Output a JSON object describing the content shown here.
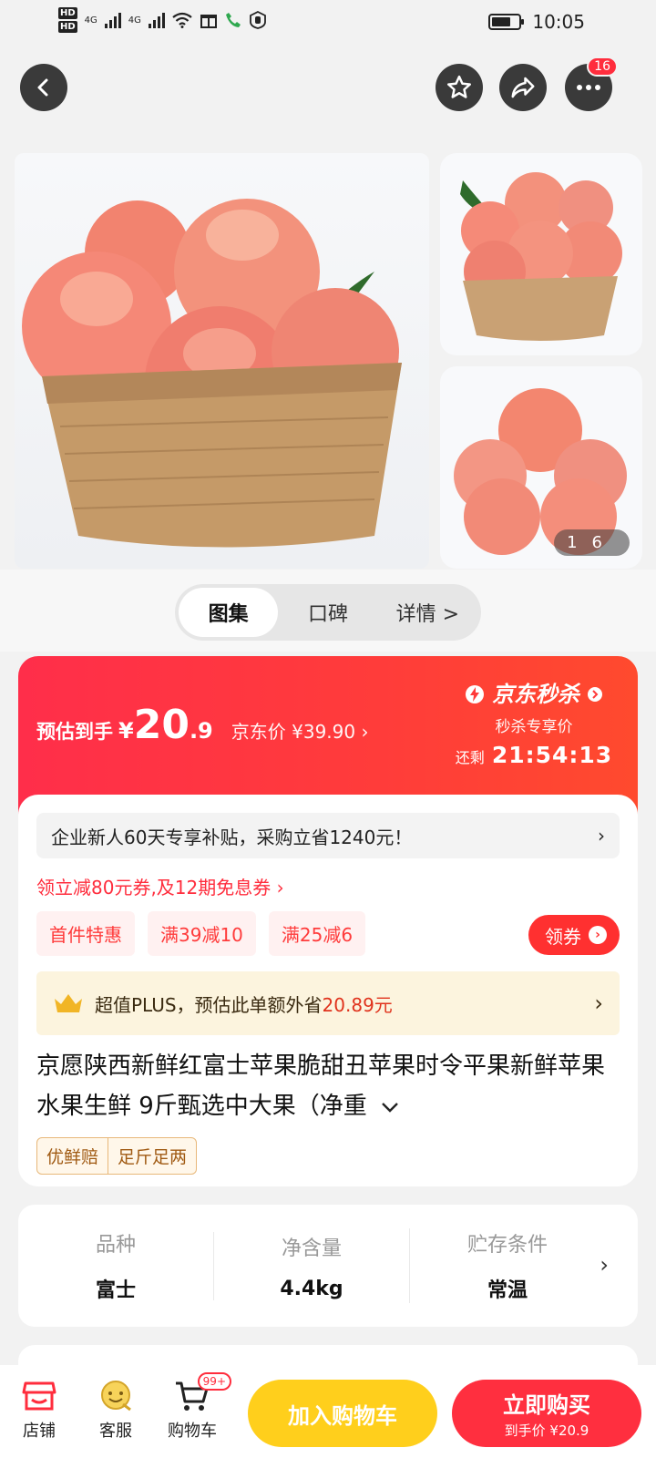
{
  "status_bar": {
    "time": "10:05",
    "sim1": "HD",
    "sim2": "HD",
    "net1": "4G",
    "net2": "4G"
  },
  "nav": {
    "more_badge": "16"
  },
  "gallery": {
    "counter_current": "1",
    "counter_total": "6"
  },
  "tabs": [
    {
      "label": "图集"
    },
    {
      "label": "口碑"
    },
    {
      "label": "详情 >"
    }
  ],
  "price": {
    "prefix": "预估到手",
    "yen": "¥",
    "integer": "20",
    "decimal": ".9",
    "jd_price": "京东价 ¥39.90 ›",
    "seckill_title": "京东秒杀",
    "seckill_sub": "秒杀专享价",
    "countdown_label": "还剩",
    "countdown": "21:54:13"
  },
  "promo": {
    "enterprise": "企业新人60天专享补贴，采购立省1240元！",
    "coupon_line": "领立减80元券,及12期免息券 ›",
    "tags": [
      "首件特惠",
      "满39减10",
      "满25减6"
    ],
    "claim": "领券",
    "plus_text": "超值PLUS，预估此单额外省",
    "plus_amount": "20.89元"
  },
  "product": {
    "title": "京愿陕西新鲜红富士苹果脆甜丑苹果时令平果新鲜苹果水果生鲜 9斤甄选中大果（净重",
    "service_tags": [
      "优鲜赔",
      "足斤足两"
    ]
  },
  "specs": [
    {
      "label": "品种",
      "value": "富士"
    },
    {
      "label": "净含量",
      "value": "4.4kg"
    },
    {
      "label": "贮存条件",
      "value": "常温"
    }
  ],
  "bottom": {
    "store": "店铺",
    "service": "客服",
    "cart": "购物车",
    "cart_badge": "99+",
    "add_to_cart": "加入购物车",
    "buy_now": "立即购买",
    "buy_sub": "到手价 ¥20.9"
  },
  "colors": {
    "accent_red": "#ff2d3d",
    "cart_yellow": "#ffcf1c",
    "plus_bg": "#fcf4de"
  }
}
